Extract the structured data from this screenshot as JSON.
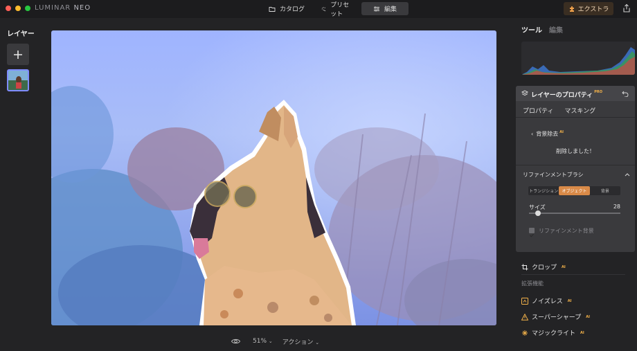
{
  "app": {
    "brand": "LUMINAR",
    "brand_suffix": "NEO",
    "colors": {
      "close": "#ff5f57",
      "minimize": "#febc2e",
      "zoom": "#28c840",
      "accent": "#d98a48",
      "pro_badge": "#f5b34a"
    }
  },
  "topbar": {
    "tabs": [
      {
        "label": "カタログ",
        "icon": "folder-icon"
      },
      {
        "label": "プリセット",
        "icon": "sparkle-icon"
      },
      {
        "label": "編集",
        "icon": "sliders-icon"
      }
    ],
    "active_tab": "編集",
    "extra_label": "エクストラ"
  },
  "left": {
    "title": "レイヤー"
  },
  "bottom": {
    "zoom": "51%",
    "actions": "アクション"
  },
  "right": {
    "tab_tools": "ツール",
    "tab_edit": "編集",
    "props_title": "レイヤーのプロパティ",
    "props_badge": "PRO",
    "props_tabs": [
      "プロパティ",
      "マスキング"
    ],
    "bg_removal": "背景除去",
    "ai_badge": "AI",
    "deleted_msg": "削除しました！",
    "refine_title": "リファインメントブラシ",
    "segments": [
      "トランジション",
      "オブジェクト",
      "背景"
    ],
    "active_segment": "オブジェクト",
    "size_label": "サイズ",
    "size_value": "28",
    "size_level": 0.1,
    "refine_bg_label": "リファインメント背景",
    "crop": "クロップ",
    "extensions": "拡張機能",
    "noiseless": "ノイズレス",
    "supersharp": "スーパーシャープ",
    "magiclight": "マジックライト"
  }
}
